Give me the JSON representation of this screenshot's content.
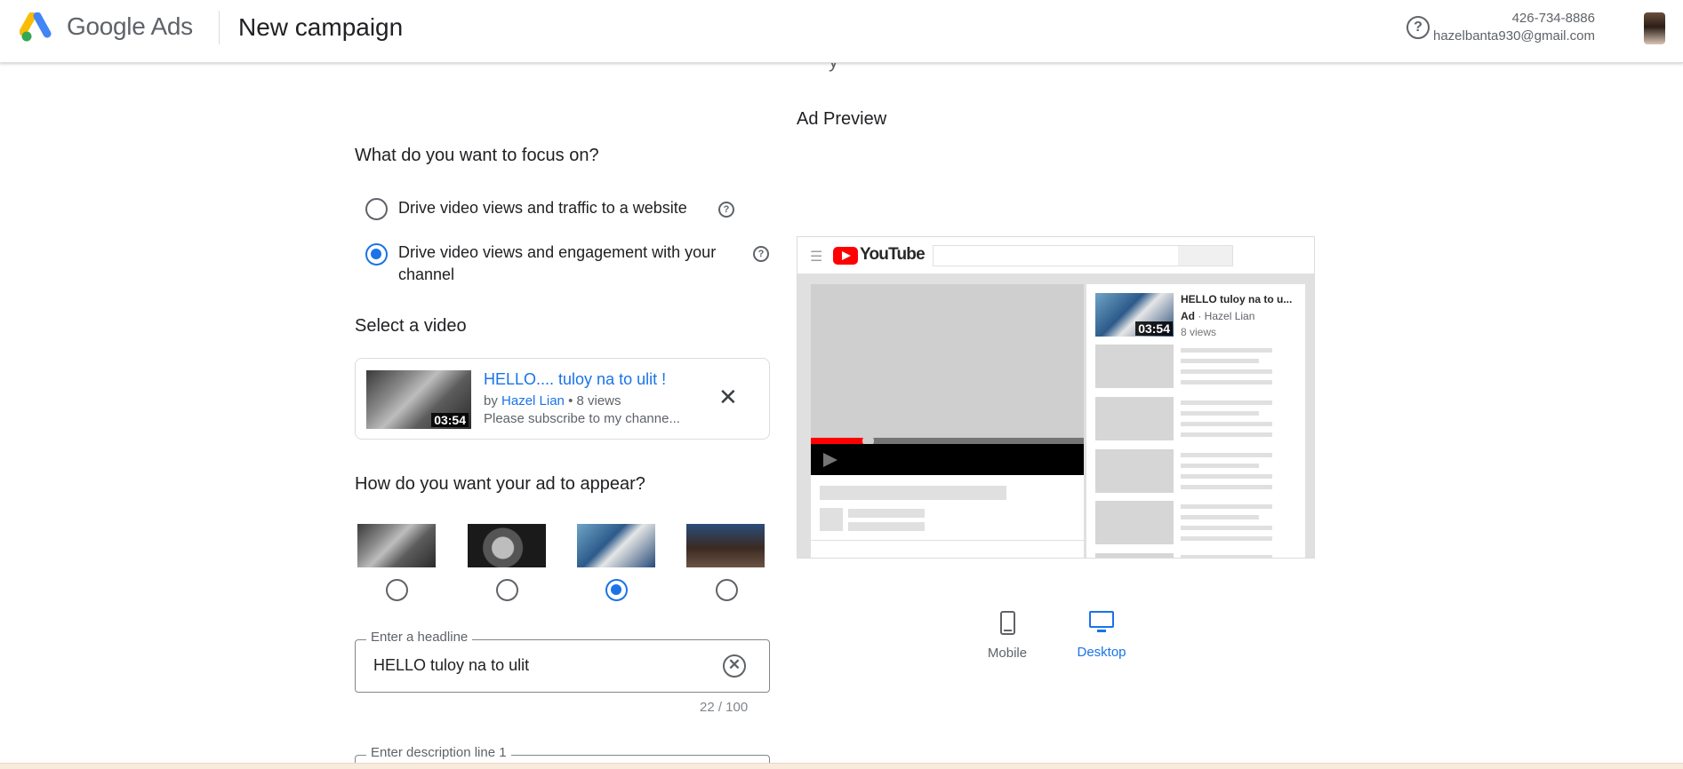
{
  "header": {
    "brand_google": "Google",
    "brand_ads": "Ads",
    "title": "New campaign",
    "help_icon": "help-circle-icon",
    "account_phone": "426-734-8886",
    "account_email": "hazelbanta930@gmail.com"
  },
  "focus": {
    "heading": "What do you want to focus on?",
    "options": [
      {
        "label": "Drive video views and traffic to a website",
        "selected": false
      },
      {
        "label_line1": "Drive video views and engagement with your",
        "label_line2": "channel",
        "selected": true
      }
    ]
  },
  "select_video": {
    "heading": "Select a video",
    "video": {
      "title": "HELLO.... tuloy na to ulit !",
      "by_prefix": "by",
      "channel": "Hazel Lian",
      "views": "• 8 views",
      "description": "Please subscribe to my channe...",
      "duration": "03:54"
    }
  },
  "appearance": {
    "heading": "How do you want your ad to appear?",
    "selected_index": 2
  },
  "headline": {
    "label": "Enter a headline",
    "value": "HELLO tuloy na to ulit",
    "counter": "22 / 100"
  },
  "description1": {
    "label": "Enter description line 1"
  },
  "preview": {
    "title": "Ad Preview",
    "youtube_logo": "YouTube",
    "ad_title": "HELLO tuloy na to u...",
    "ad_badge": "Ad",
    "ad_channel": "· Hazel Lian",
    "ad_views": "8 views",
    "duration": "03:54",
    "devices": [
      {
        "label": "Mobile",
        "icon": "phone-icon",
        "active": false
      },
      {
        "label": "Desktop",
        "icon": "desktop-icon",
        "active": true
      }
    ]
  },
  "colors": {
    "accent": "#1a73e8",
    "yt_red": "#ff0000"
  }
}
